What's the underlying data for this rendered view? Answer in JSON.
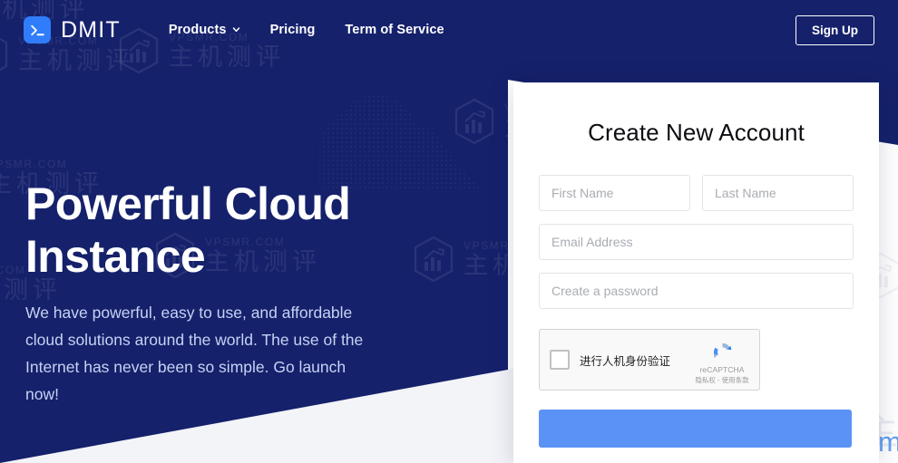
{
  "brand": {
    "name": "DMIT",
    "logo_icon": "terminal-prompt-icon",
    "logo_color": "#2f7dfb"
  },
  "nav": {
    "items": [
      {
        "label": "Products",
        "has_dropdown": true,
        "icon": "chevron-down-icon"
      },
      {
        "label": "Pricing",
        "has_dropdown": false
      },
      {
        "label": "Term of Service",
        "has_dropdown": false
      }
    ],
    "signup_label": "Sign Up"
  },
  "hero": {
    "heading": "Powerful Cloud Instance",
    "paragraph": "We have powerful, easy to use, and affordable cloud solutions around the world. The use of the Internet has never been so simple. Go launch now!"
  },
  "form": {
    "title": "Create New Account",
    "first_name": {
      "value": "",
      "placeholder": "First Name"
    },
    "last_name": {
      "value": "",
      "placeholder": "Last Name"
    },
    "email": {
      "value": "",
      "placeholder": "Email Address"
    },
    "password": {
      "value": "",
      "placeholder": "Create a password"
    },
    "recaptcha": {
      "checkbox_label": "进行人机身份验证",
      "brand_name": "reCAPTCHA",
      "terms": "隐私权 - 使用条款",
      "logo_icon": "recaptcha-icon",
      "checked": false
    },
    "submit_label": ""
  },
  "watermark": {
    "cn_text": "主机测评",
    "latin_text": "VPSMR.COM",
    "overlay_cn": "主机测评",
    "overlay_site": "vpsmr.com",
    "logo_icon": "hexagon-chart-icon",
    "overlay_color": "#62a0ef"
  },
  "theme": {
    "hero_bg": "#15216b",
    "accent_blue": "#5b92f5",
    "card_bg": "#ffffff",
    "hero_text": "#ffffff",
    "hero_subtext": "#c6d2f2"
  }
}
